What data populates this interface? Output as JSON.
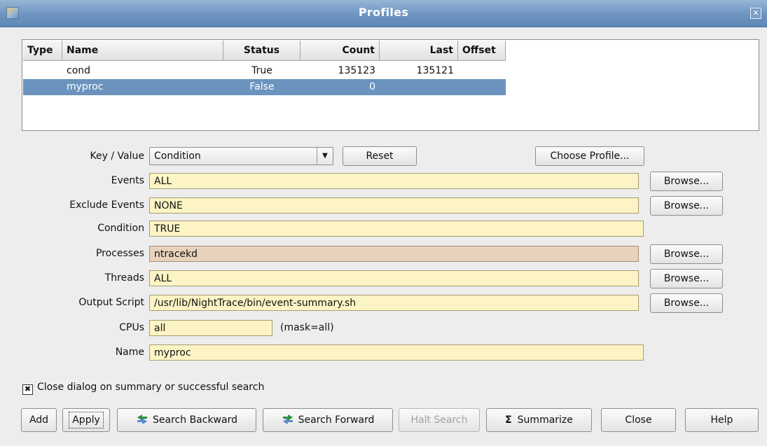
{
  "window": {
    "title": "Profiles"
  },
  "table": {
    "headers": {
      "type": "Type",
      "name": "Name",
      "status": "Status",
      "count": "Count",
      "last": "Last",
      "offset": "Offset"
    },
    "rows": [
      {
        "type": "",
        "name": "cond",
        "status": "True",
        "count": "135123",
        "last": "135121",
        "offset": "",
        "selected": false
      },
      {
        "type": "",
        "name": "myproc",
        "status": "False",
        "count": "0",
        "last": "",
        "offset": "",
        "selected": true
      }
    ]
  },
  "form": {
    "key_value": {
      "label": "Key / Value",
      "value": "Condition"
    },
    "reset_label": "Reset",
    "choose_profile_label": "Choose Profile...",
    "events": {
      "label": "Events",
      "value": "ALL"
    },
    "exclude_events": {
      "label": "Exclude Events",
      "value": "NONE"
    },
    "condition": {
      "label": "Condition",
      "value": "TRUE"
    },
    "processes": {
      "label": "Processes",
      "value": "ntracekd"
    },
    "threads": {
      "label": "Threads",
      "value": "ALL"
    },
    "output_script": {
      "label": "Output Script",
      "value": "/usr/lib/NightTrace/bin/event-summary.sh"
    },
    "cpus": {
      "label": "CPUs",
      "value": "all",
      "mask": "(mask=all)"
    },
    "name": {
      "label": "Name",
      "value": "myproc"
    },
    "browse_label": "Browse..."
  },
  "options": {
    "close_dialog_label": "Close dialog on summary or successful search",
    "close_dialog_checked": true
  },
  "buttons": {
    "add": "Add",
    "apply": "Apply",
    "search_backward": "Search Backward",
    "search_forward": "Search Forward",
    "halt_search": "Halt Search",
    "summarize": "Summarize",
    "summarize_symbol": "Σ",
    "close": "Close",
    "help": "Help"
  },
  "colors": {
    "title_bar": "#6d94bf",
    "selection": "#6b93bd",
    "field_bg": "#fdf4c5",
    "field_highlight_bg": "#e8d2bb"
  }
}
